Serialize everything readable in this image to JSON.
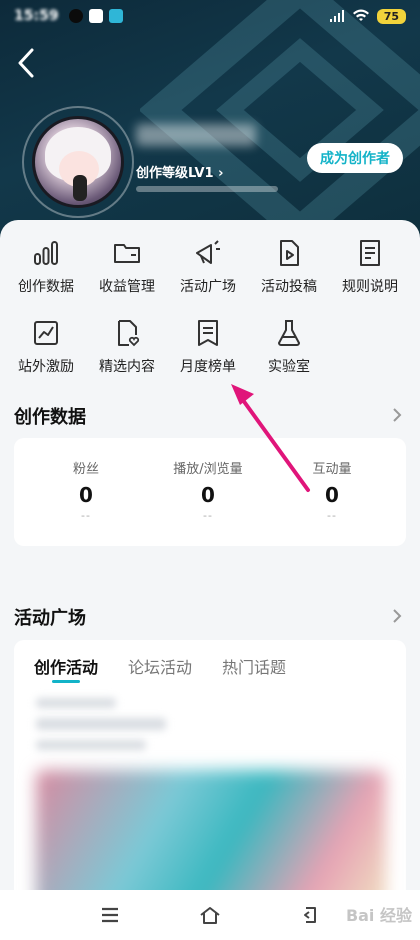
{
  "status_bar": {
    "time": "15:59",
    "battery": "75"
  },
  "profile": {
    "level": "创作等级LV1",
    "become_creator": "成为创作者"
  },
  "tools": [
    {
      "label": "创作数据",
      "icon": "bar-chart-icon"
    },
    {
      "label": "收益管理",
      "icon": "wallet-icon"
    },
    {
      "label": "活动广场",
      "icon": "megaphone-icon"
    },
    {
      "label": "活动投稿",
      "icon": "video-file-icon"
    },
    {
      "label": "规则说明",
      "icon": "document-icon"
    },
    {
      "label": "站外激励",
      "icon": "trend-chart-icon"
    },
    {
      "label": "精选内容",
      "icon": "file-heart-icon"
    },
    {
      "label": "月度榜单",
      "icon": "ribbon-list-icon"
    },
    {
      "label": "实验室",
      "icon": "flask-icon"
    }
  ],
  "creation_data": {
    "title": "创作数据",
    "stats": [
      {
        "label": "粉丝",
        "value": "0",
        "change": "--"
      },
      {
        "label": "播放/浏览量",
        "value": "0",
        "change": "--"
      },
      {
        "label": "互动量",
        "value": "0",
        "change": "--"
      }
    ]
  },
  "activity": {
    "title": "活动广场",
    "tabs": [
      {
        "label": "创作活动",
        "active": true
      },
      {
        "label": "论坛活动",
        "active": false
      },
      {
        "label": "热门话题",
        "active": false
      }
    ]
  },
  "nav": {
    "items": [
      "menu-icon",
      "home-icon",
      "back-icon"
    ]
  },
  "watermark": "Bai 经验",
  "colors": {
    "accent": "#12b3c8",
    "arrow": "#e0157a",
    "header": "#12384a"
  }
}
